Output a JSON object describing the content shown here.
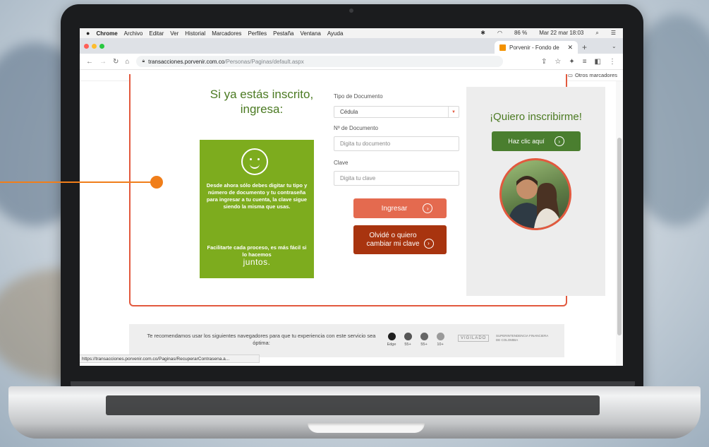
{
  "menubar": {
    "app": "Chrome",
    "items": [
      "Archivo",
      "Editar",
      "Ver",
      "Historial",
      "Marcadores",
      "Perfiles",
      "Pestaña",
      "Ventana",
      "Ayuda"
    ],
    "battery": "86 %",
    "clock": "Mar 22 mar 18:03"
  },
  "tab": {
    "title": "Porvenir - Fondo de"
  },
  "address": {
    "host": "transacciones.porvenir.com.co",
    "path": "/Personas/Paginas/default.aspx"
  },
  "bookmarks": {
    "other": "Otros marcadores"
  },
  "login": {
    "title_line1": "Si ya estás inscrito,",
    "title_line2": "ingresa:",
    "info_text": "Desde ahora sólo debes digitar tu tipo y número de documento y tu contraseña para ingresar a tu cuenta, la clave sigue siendo la misma que usas.",
    "info_text2": "Facilitarte cada proceso, es más fácil si lo hacemos",
    "info_text3": "juntos.",
    "doc_type_label": "Tipo de Documento",
    "doc_type_value": "Cédula",
    "doc_number_label": "Nº de Documento",
    "doc_number_placeholder": "Digita tu documento",
    "password_label": "Clave",
    "password_placeholder": "Digita tu clave",
    "submit_label": "Ingresar",
    "forgot_line1": "Olvidé o quiero",
    "forgot_line2": "cambiar mi clave"
  },
  "signup": {
    "title": "¡Quiero inscribirme!",
    "button_label": "Haz clic aquí"
  },
  "footer": {
    "recommendation": "Te recomendamos usar los siguientes navegadores para que tu experiencia con este servicio sea óptima:",
    "browsers": [
      {
        "name": "edge-icon",
        "label": "Edge",
        "color": "#1f1f1f"
      },
      {
        "name": "chrome-icon",
        "label": "55+",
        "color": "#555555"
      },
      {
        "name": "firefox-icon",
        "label": "55+",
        "color": "#666666"
      },
      {
        "name": "safari-icon",
        "label": "10+",
        "color": "#9a9a9a"
      }
    ],
    "vigilado": "VIGILADO",
    "supervisor": "SUPERINTENDENCIA FINANCIERA DE COLOMBIA"
  },
  "status_url": "https://transacciones.porvenir.com.co/Paginas/RecuperarContrasena.a..."
}
